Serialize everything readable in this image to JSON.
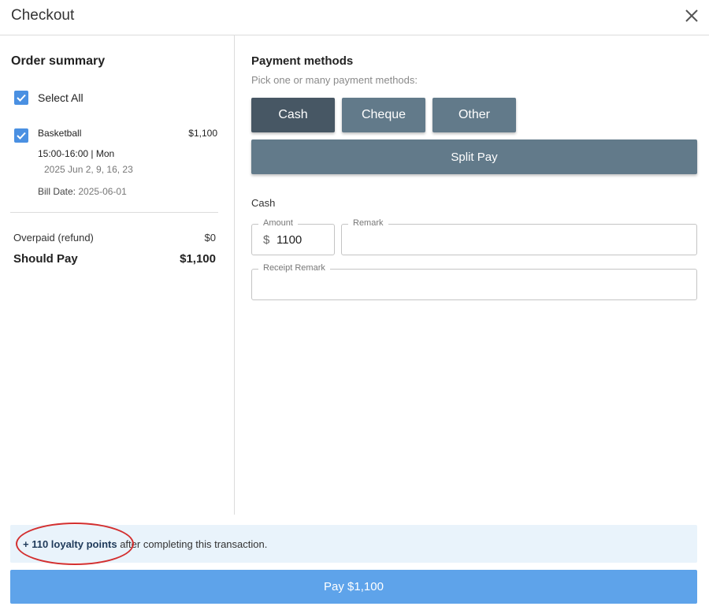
{
  "dialog": {
    "title": "Checkout"
  },
  "order_summary": {
    "title": "Order summary",
    "select_all_label": "Select All",
    "select_all_checked": true,
    "items": [
      {
        "checked": true,
        "name": "Basketball",
        "price": "$1,100",
        "time": "15:00-16:00 | Mon",
        "dates": "2025 Jun 2, 9, 16, 23",
        "bill_date_label": "Bill Date:",
        "bill_date": "2025-06-01"
      }
    ],
    "overpaid_label": "Overpaid (refund)",
    "overpaid_value": "$0",
    "should_pay_label": "Should Pay",
    "should_pay_value": "$1,100"
  },
  "payment": {
    "title": "Payment methods",
    "subtitle": "Pick one or many payment methods:",
    "methods": [
      {
        "label": "Cash",
        "selected": true
      },
      {
        "label": "Cheque",
        "selected": false
      },
      {
        "label": "Other",
        "selected": false
      }
    ],
    "split_label": "Split Pay",
    "section_label": "Cash",
    "amount_label": "Amount",
    "currency_symbol": "$",
    "amount_value": "1100",
    "remark_label": "Remark",
    "remark_value": "",
    "receipt_remark_label": "Receipt Remark",
    "receipt_remark_value": ""
  },
  "footer": {
    "points_text": "+ 110 loyalty points",
    "points_suffix": " after completing this transaction.",
    "pay_label": "Pay $1,100"
  },
  "colors": {
    "method_active": "#475764",
    "method_default": "#627a8a",
    "pay_button": "#5ea3ea",
    "checkbox": "#4a90e2",
    "annotation_circle": "#d32f2f"
  }
}
